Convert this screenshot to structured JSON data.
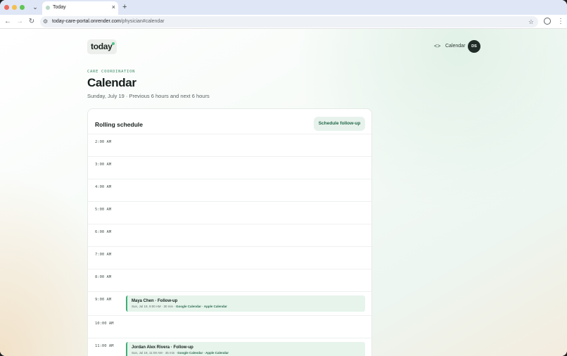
{
  "browser": {
    "tab_title": "Today",
    "tab_close": "×",
    "new_tab": "+",
    "url_host": "today-care-portal.onrender.com",
    "url_path": "/physician#calendar"
  },
  "header": {
    "logo": "today",
    "nav_code_icon": "<>",
    "nav_link": "Calendar",
    "avatar_initials": "DS"
  },
  "intro": {
    "eyebrow": "CARE COORDINATION",
    "title": "Calendar",
    "subtitle": "Sunday, July 19 · Previous 6 hours and next 6 hours"
  },
  "schedule": {
    "title": "Rolling schedule",
    "button": "Schedule follow-up",
    "hours": [
      {
        "label": "2:00 AM"
      },
      {
        "label": "3:00 AM"
      },
      {
        "label": "4:00 AM"
      },
      {
        "label": "5:00 AM"
      },
      {
        "label": "6:00 AM"
      },
      {
        "label": "7:00 AM"
      },
      {
        "label": "8:00 AM"
      },
      {
        "label": "9:00 AM",
        "event": {
          "title": "Maya Chen · Follow-up",
          "meta": "Sun, Jul 19, 9:00 AM · 30 min · ",
          "cal": "Google Calendar · Apple Calendar"
        }
      },
      {
        "label": "10:00 AM"
      },
      {
        "label": "11:00 AM",
        "event": {
          "title": "Jordan Alex Rivera · Follow-up",
          "meta": "Sun, Jul 19, 11:00 AM · 45 min · ",
          "cal": "Google Calendar · Apple Calendar"
        }
      }
    ]
  }
}
